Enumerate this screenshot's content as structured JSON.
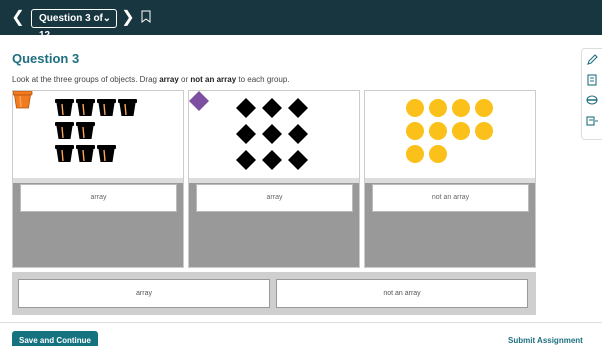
{
  "nav": {
    "question_selector": "Question 3 of 12",
    "prev_icon": "chevron-left-icon",
    "next_icon": "chevron-right-icon",
    "bookmark_icon": "bookmark-icon"
  },
  "question": {
    "title": "Question 3",
    "instruction_before": "Look at the three groups of objects. Drag ",
    "instruction_option1": "array",
    "instruction_middle": " or ",
    "instruction_option2": "not an array",
    "instruction_after": " to each group."
  },
  "groups": [
    {
      "object": "orange-flower-pots",
      "color": "#f07c1f",
      "rows": [
        4,
        2,
        3
      ],
      "answer": "array"
    },
    {
      "object": "purple-diamonds",
      "color": "#7d4fa1",
      "rows": [
        3,
        3,
        3
      ],
      "answer": "array"
    },
    {
      "object": "yellow-circles",
      "color": "#fbc11a",
      "rows": [
        4,
        4,
        2
      ],
      "answer": "not an array"
    }
  ],
  "answer_bank": [
    "array",
    "not an array"
  ],
  "tools": [
    "pencil-icon",
    "notepad-icon",
    "highlighter-icon",
    "reader-icon"
  ],
  "footer": {
    "save_button": "Save and Continue",
    "submit_link": "Submit Assignment"
  },
  "colors": {
    "nav_bg": "#17363f",
    "accent": "#15727f",
    "title": "#1e6f80"
  }
}
